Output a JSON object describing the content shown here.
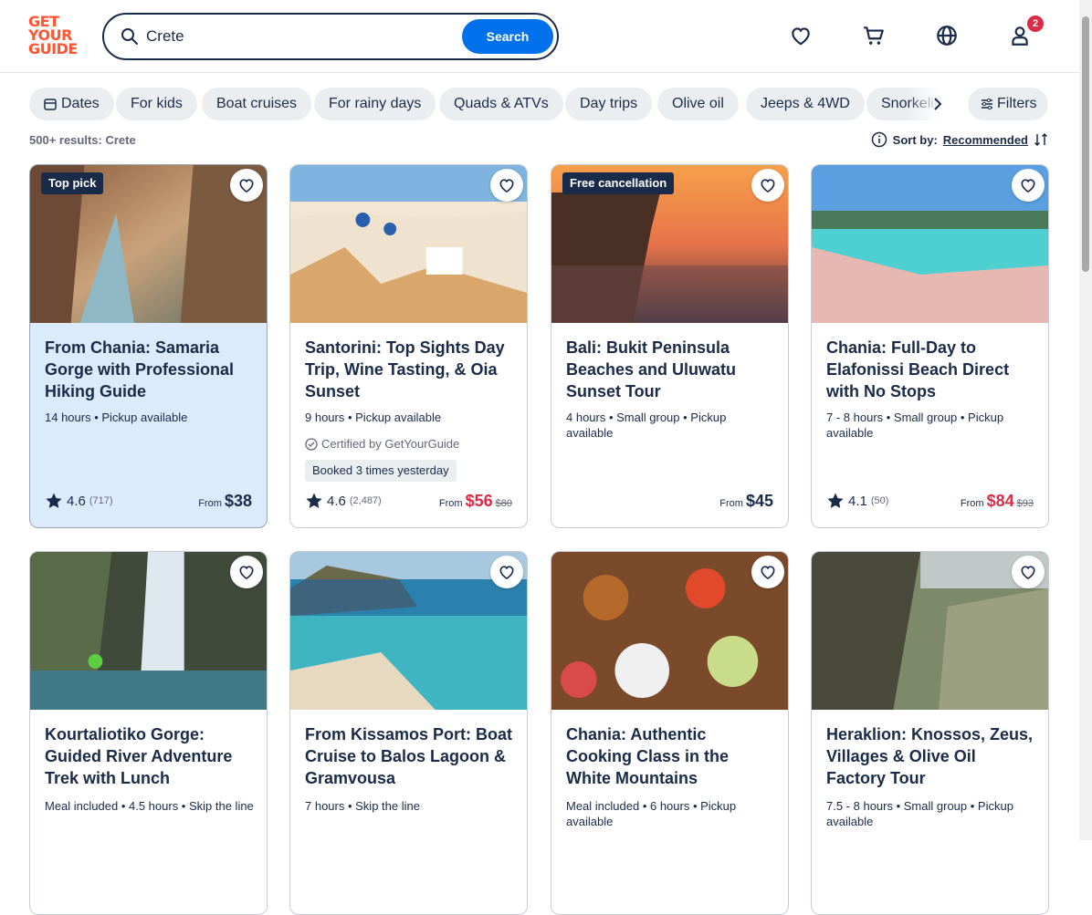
{
  "logo": {
    "line1": "GET",
    "line2": "YOUR",
    "line3": "GUIDE",
    "color": "#ff5533"
  },
  "search": {
    "value": "Crete",
    "button": "Search"
  },
  "header": {
    "cart_badge": "2"
  },
  "chips": [
    "Dates",
    "For kids",
    "Boat cruises",
    "For rainy days",
    "Quads & ATVs",
    "Day trips",
    "Olive oil",
    "Jeeps & 4WD",
    "Snorkeling"
  ],
  "filters_label": "Filters",
  "results": "500+ results: Crete",
  "sort": {
    "label": "Sort by:",
    "value": "Recommended"
  },
  "colors": {
    "accent": "#0071eb",
    "sale": "#dc2b44",
    "text": "#1a2b49"
  },
  "cards": [
    {
      "tag": "Top pick",
      "title": "From Chania: Samaria Gorge with Professional Hiking Guide",
      "meta": "14 hours • Pickup available",
      "rating": "4.6",
      "reviews": "(717)",
      "from": "From",
      "price": "$38",
      "old": ""
    },
    {
      "tag": "",
      "title": "Santorini: Top Sights Day Trip, Wine Tasting, & Oia Sunset",
      "meta": "9 hours • Pickup available",
      "cert": "Certified by GetYourGuide",
      "booked": "Booked 3 times yesterday",
      "rating": "4.6",
      "reviews": "(2,487)",
      "from": "From",
      "price": "$56",
      "old": "$80"
    },
    {
      "tag": "Free cancellation",
      "title": "Bali: Bukit Peninsula Beaches and Uluwatu Sunset Tour",
      "meta": "4 hours • Small group • Pickup available",
      "rating": "",
      "reviews": "",
      "from": "From",
      "price": "$45",
      "old": ""
    },
    {
      "tag": "",
      "title": "Chania: Full-Day to Elafonissi Beach Direct with No Stops",
      "meta": "7 - 8 hours • Small group • Pickup available",
      "rating": "4.1",
      "reviews": "(50)",
      "from": "From",
      "price": "$84",
      "old": "$93"
    },
    {
      "tag": "",
      "title": "Kourtaliotiko Gorge: Guided River Adventure Trek with Lunch",
      "meta": "Meal included • 4.5 hours • Skip the line"
    },
    {
      "tag": "",
      "title": "From Kissamos Port: Boat Cruise to Balos Lagoon & Gramvousa",
      "meta": "7 hours • Skip the line"
    },
    {
      "tag": "",
      "title": "Chania: Authentic Cooking Class in the White Mountains",
      "meta": "Meal included • 6 hours • Pickup available"
    },
    {
      "tag": "",
      "title": "Heraklion: Knossos, Zeus, Villages & Olive Oil Factory Tour",
      "meta": "7.5 - 8 hours • Small group • Pickup available"
    }
  ]
}
